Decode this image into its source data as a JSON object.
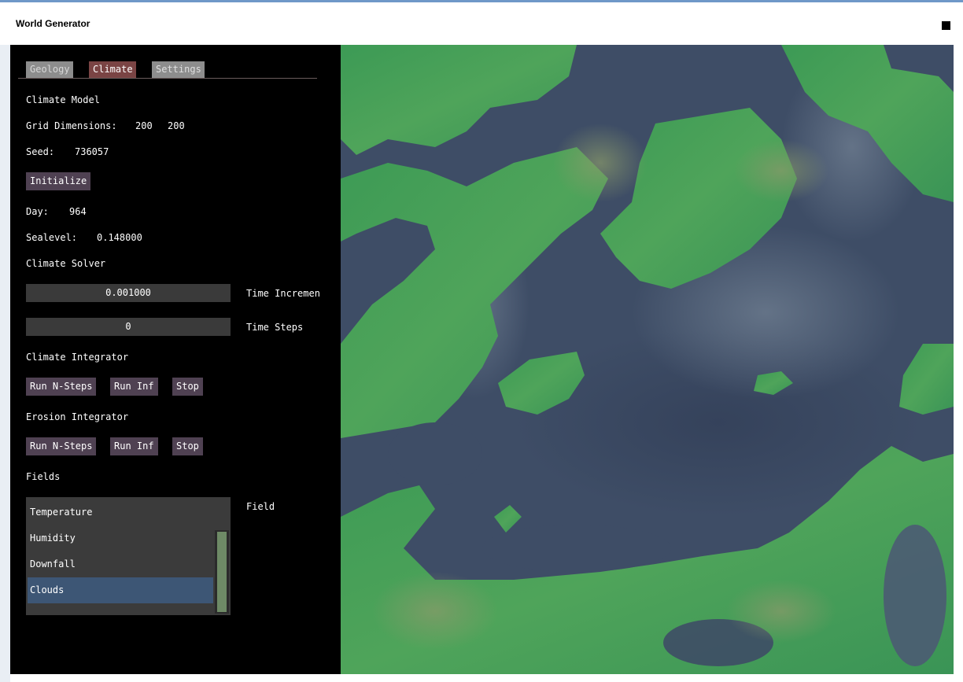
{
  "window": {
    "title": "World Generator"
  },
  "tabs": [
    "Geology",
    "Climate",
    "Settings"
  ],
  "active_tab": "Climate",
  "climate_model": {
    "heading": "Climate Model",
    "grid_label": "Grid Dimensions:",
    "grid_x": "200",
    "grid_y": "200",
    "seed_label": "Seed:",
    "seed_value": "736057",
    "initialize_button": "Initialize",
    "day_label": "Day:",
    "day_value": "964",
    "sealevel_label": "Sealevel:",
    "sealevel_value": "0.148000"
  },
  "climate_solver": {
    "heading": "Climate Solver",
    "time_increment_value": "0.001000",
    "time_increment_label": "Time Incremen",
    "time_steps_value": "0",
    "time_steps_label": "Time Steps"
  },
  "climate_integrator": {
    "heading": "Climate Integrator",
    "run_n_steps": "Run N-Steps",
    "run_inf": "Run Inf",
    "stop": "Stop"
  },
  "erosion_integrator": {
    "heading": "Erosion Integrator",
    "run_n_steps": "Run N-Steps",
    "run_inf": "Run Inf",
    "stop": "Stop"
  },
  "fields": {
    "heading": "Fields",
    "label": "Field",
    "items": [
      "Temperature",
      "Humidity",
      "Downfall",
      "Clouds"
    ],
    "selected": "Clouds"
  },
  "colors": {
    "panel_bg": "#000000",
    "tab_active": "#7a4444",
    "tab_inactive": "#8d8d8d",
    "button_bg": "#4f4152",
    "slider_bg": "#3a3a3a",
    "list_selected": "#3d5675",
    "water": "#3e4d66",
    "land": "#3f9a58"
  }
}
